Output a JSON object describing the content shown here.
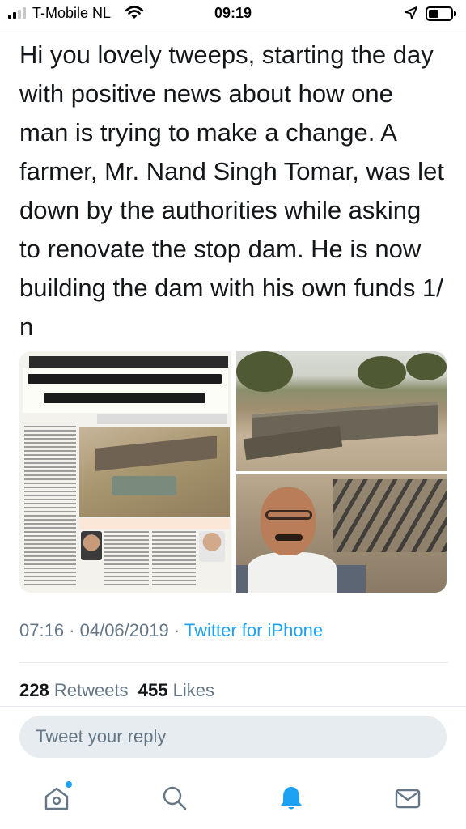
{
  "status_bar": {
    "carrier": "T-Mobile NL",
    "time": "09:19"
  },
  "tweet": {
    "text": "Hi you lovely tweeps, starting the day with positive news about how one man is trying to make a change. A farmer, Mr. Nand Singh Tomar, was let down by the authorities while asking to renovate the stop dam. He is now building the dam with his own funds 1/ n",
    "timestamp": "07:16 · 04/06/2019 · ",
    "source": "Twitter for iPhone"
  },
  "stats": {
    "retweets_count": "228",
    "retweets_label": "Retweets",
    "likes_count": "455",
    "likes_label": "Likes"
  },
  "reply": {
    "placeholder": "Tweet your reply"
  },
  "tab_bar": {
    "items": [
      {
        "icon": "home-icon",
        "active": false,
        "badge": true
      },
      {
        "icon": "search-icon",
        "active": false,
        "badge": false
      },
      {
        "icon": "notifications-icon",
        "active": true,
        "badge": false
      },
      {
        "icon": "messages-icon",
        "active": false,
        "badge": false
      }
    ]
  },
  "colors": {
    "accent": "#1da1f2",
    "secondary_text": "#657786",
    "primary_text": "#14171a",
    "divider": "#e6ecf0"
  }
}
